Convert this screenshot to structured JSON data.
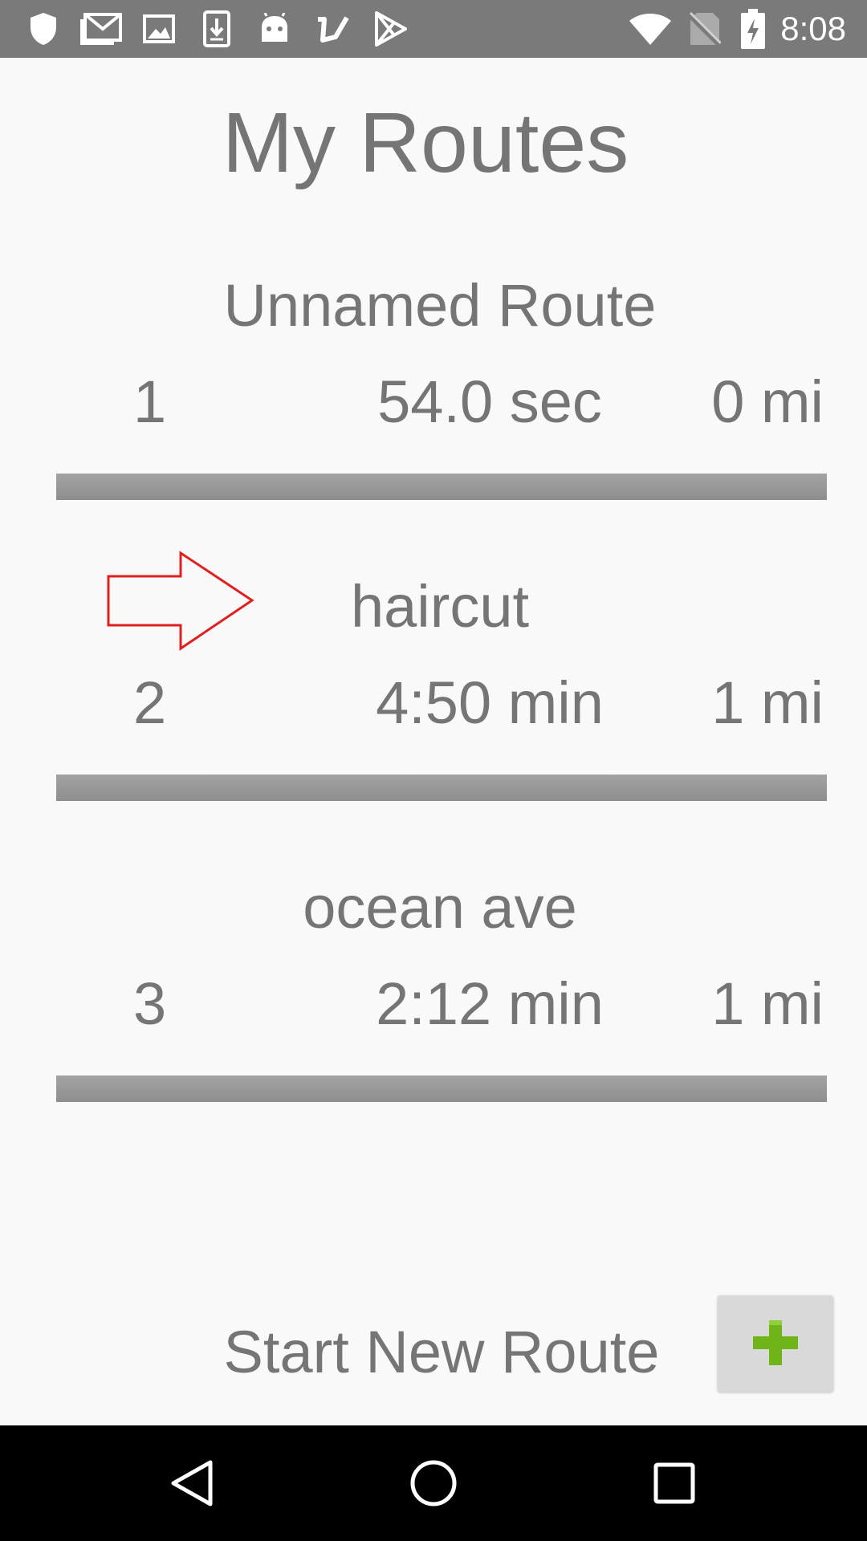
{
  "status_bar": {
    "time": "8:08",
    "left_icons": [
      "shield-icon",
      "gmail-icon",
      "image-icon",
      "download-icon",
      "android-icon",
      "checkmark-app-icon",
      "play-store-icon"
    ],
    "right_icons": [
      "wifi-icon",
      "no-sim-icon",
      "battery-charging-icon"
    ]
  },
  "page": {
    "title": "My Routes"
  },
  "routes": [
    {
      "name": "Unnamed Route",
      "number": "1",
      "duration": "54.0 sec",
      "distance": "0 mi"
    },
    {
      "name": "haircut",
      "number": "2",
      "duration": "4:50 min",
      "distance": "1 mi"
    },
    {
      "name": "ocean ave",
      "number": "3",
      "duration": "2:12 min",
      "distance": "1 mi"
    }
  ],
  "annotation": {
    "icon": "red-arrow-icon",
    "color": "#e02020",
    "points_to_route": "haircut"
  },
  "actions": {
    "start_new_route_label": "Start New Route",
    "add_icon": "plus-icon",
    "add_icon_color": "#6fb51a"
  },
  "nav_bar": {
    "buttons": [
      "back-icon",
      "home-icon",
      "recents-icon"
    ]
  }
}
